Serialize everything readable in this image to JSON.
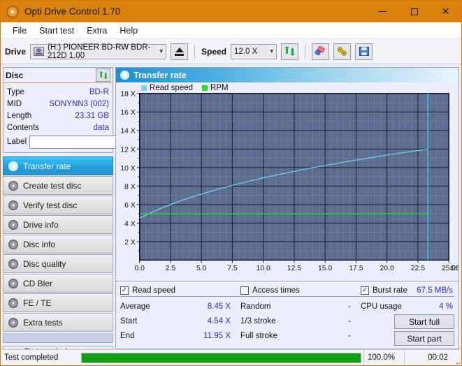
{
  "window": {
    "title": "Opti Drive Control 1.70",
    "icon": "disc-icon",
    "minimize": "minimize",
    "maximize": "maximize",
    "close": "close"
  },
  "menu": {
    "items": [
      {
        "label": "File"
      },
      {
        "label": "Start test"
      },
      {
        "label": "Extra"
      },
      {
        "label": "Help"
      }
    ]
  },
  "toolbar": {
    "drive_label": "Drive",
    "drive_value": "(H:)  PIONEER BD-RW   BDR-212D 1.00",
    "eject_title": "Eject",
    "speed_label": "Speed",
    "speed_value": "12.0 X",
    "refresh_title": "Refresh",
    "erase_title": "Erase",
    "tools_title": "Tools",
    "save_title": "Save"
  },
  "disc": {
    "title": "Disc",
    "refresh_title": "Refresh disc info",
    "rows": [
      {
        "key": "Type",
        "value": "BD-R"
      },
      {
        "key": "MID",
        "value": "SONYNN3 (002)"
      },
      {
        "key": "Length",
        "value": "23.31 GB"
      },
      {
        "key": "Contents",
        "value": "data"
      }
    ],
    "label_key": "Label",
    "label_value": "",
    "label_placeholder": "",
    "label_button_title": "Disc label"
  },
  "sidebar": {
    "items": [
      {
        "label": "Transfer rate",
        "active": true
      },
      {
        "label": "Create test disc",
        "active": false
      },
      {
        "label": "Verify test disc",
        "active": false
      },
      {
        "label": "Drive info",
        "active": false
      },
      {
        "label": "Disc info",
        "active": false
      },
      {
        "label": "Disc quality",
        "active": false
      },
      {
        "label": "CD Bler",
        "active": false
      },
      {
        "label": "FE / TE",
        "active": false
      },
      {
        "label": "Extra tests",
        "active": false
      }
    ],
    "status_window": "Status window > >"
  },
  "panel": {
    "title": "Transfer rate"
  },
  "chart_data": {
    "type": "line",
    "title": "Transfer rate",
    "xlabel": "GB",
    "ylabel": "X",
    "xlim": [
      0.0,
      25.0
    ],
    "ylim": [
      0,
      18
    ],
    "xticks": [
      "0.0",
      "2.5",
      "5.0",
      "7.5",
      "10.0",
      "12.5",
      "15.0",
      "17.5",
      "20.0",
      "22.5",
      "25.0"
    ],
    "xtick_values": [
      0.0,
      2.5,
      5.0,
      7.5,
      10.0,
      12.5,
      15.0,
      17.5,
      20.0,
      22.5,
      25.0
    ],
    "x_unit_label": "GB",
    "yticks": [
      "2 X",
      "4 X",
      "6 X",
      "8 X",
      "10 X",
      "12 X",
      "14 X",
      "16 X",
      "18 X"
    ],
    "ytick_values": [
      2,
      4,
      6,
      8,
      10,
      12,
      14,
      16,
      18
    ],
    "grid": true,
    "legend_position": "top-left",
    "legend": [
      {
        "name": "Read speed",
        "color": "#73d7f2"
      },
      {
        "name": "RPM",
        "color": "#22e022"
      }
    ],
    "marker_line": {
      "x": 23.31,
      "color": "#2fd2f5"
    },
    "series": [
      {
        "name": "Read speed",
        "color": "#73d7f2",
        "x": [
          0.0,
          0.3,
          0.8,
          1.4,
          2.1,
          3.0,
          4.0,
          5.0,
          6.0,
          7.0,
          8.0,
          9.0,
          10.0,
          11.0,
          12.0,
          13.0,
          14.0,
          15.0,
          16.0,
          17.0,
          18.0,
          19.0,
          20.0,
          21.0,
          22.0,
          23.0,
          23.31
        ],
        "values": [
          4.54,
          4.72,
          5.05,
          5.42,
          5.8,
          6.25,
          6.72,
          7.14,
          7.54,
          7.9,
          8.25,
          8.57,
          8.88,
          9.17,
          9.45,
          9.72,
          9.98,
          10.22,
          10.46,
          10.69,
          10.92,
          11.13,
          11.34,
          11.54,
          11.74,
          11.92,
          11.95
        ]
      },
      {
        "name": "RPM",
        "color": "#22e022",
        "x": [
          0.0,
          2.5,
          5.0,
          7.5,
          10.0,
          12.5,
          15.0,
          17.5,
          20.0,
          22.5,
          23.31
        ],
        "values": [
          5.0,
          5.0,
          5.0,
          5.0,
          5.0,
          5.0,
          5.0,
          5.0,
          5.02,
          5.02,
          5.02
        ]
      }
    ]
  },
  "stats": {
    "read_speed": {
      "checkbox_label": "Read speed",
      "checked": true,
      "rows": [
        {
          "key": "Average",
          "value": "8.45 X"
        },
        {
          "key": "Start",
          "value": "4.54 X"
        },
        {
          "key": "End",
          "value": "11.95 X"
        }
      ]
    },
    "access_times": {
      "checkbox_label": "Access times",
      "checked": false,
      "rows": [
        {
          "key": "Random",
          "value": "-"
        },
        {
          "key": "1/3 stroke",
          "value": "-"
        },
        {
          "key": "Full stroke",
          "value": "-"
        }
      ]
    },
    "burst": {
      "checkbox_label": "Burst rate",
      "checked": true,
      "value": "67.5 MB/s",
      "rows": [
        {
          "key": "CPU usage",
          "value": "4 %"
        }
      ],
      "start_full": "Start full",
      "start_part": "Start part"
    }
  },
  "statusbar": {
    "message": "Test completed",
    "percent_label": "100.0%",
    "percent_value": 100,
    "elapsed": "00:02"
  }
}
